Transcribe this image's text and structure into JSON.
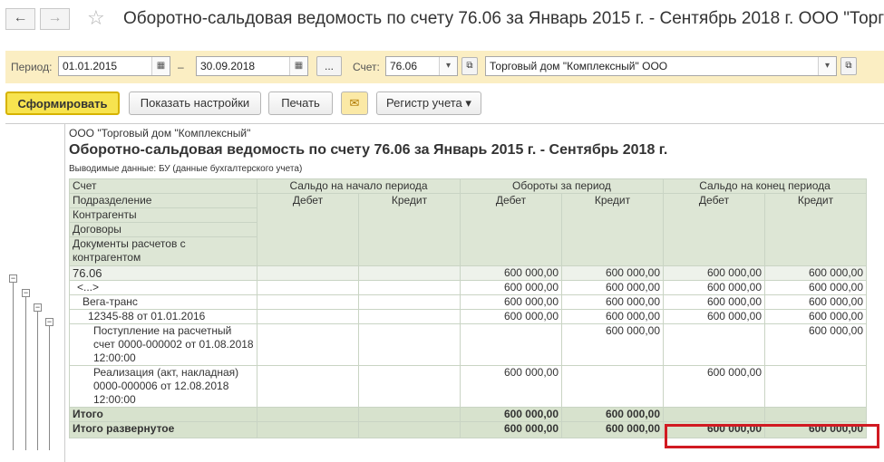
{
  "window": {
    "back_glyph": "←",
    "forward_glyph": "→",
    "star_glyph": "☆",
    "title": "Оборотно-сальдовая ведомость по счету 76.06 за Январь 2015 г. - Сентябрь 2018 г. ООО \"Торг"
  },
  "params": {
    "period_label": "Период:",
    "date_from": "01.01.2015",
    "dash": "–",
    "date_to": "30.09.2018",
    "more_label": "...",
    "account_label": "Счет:",
    "account_value": "76.06",
    "org_value": "Торговый дом \"Комплексный\" ООО"
  },
  "toolbar": {
    "generate": "Сформировать",
    "settings": "Показать настройки",
    "print": "Печать",
    "email_glyph": "✉",
    "register": "Регистр учета",
    "register_arrow": "▾"
  },
  "report": {
    "org": "ООО \"Торговый дом \"Комплексный\"",
    "title": "Оборотно-сальдовая ведомость по счету 76.06 за Январь 2015 г. - Сентябрь 2018 г.",
    "output_data": "Выводимые данные:  БУ (данные бухгалтерского учета)",
    "header": {
      "col_account": [
        "Счет",
        "Подразделение",
        "Контрагенты",
        "Договоры",
        "Документы расчетов с контрагентом"
      ],
      "opening": "Сальдо на начало периода",
      "turnover": "Обороты за период",
      "closing": "Сальдо на конец периода",
      "debit": "Дебет",
      "credit": "Кредит"
    },
    "rows": [
      {
        "name": "76.06",
        "od": "",
        "oc": "",
        "td": "600 000,00",
        "tc": "600 000,00",
        "cd": "600 000,00",
        "cc": "600 000,00"
      },
      {
        "name": "<...>",
        "od": "",
        "oc": "",
        "td": "600 000,00",
        "tc": "600 000,00",
        "cd": "600 000,00",
        "cc": "600 000,00"
      },
      {
        "name": "Вега-транс",
        "od": "",
        "oc": "",
        "td": "600 000,00",
        "tc": "600 000,00",
        "cd": "600 000,00",
        "cc": "600 000,00"
      },
      {
        "name": "12345-88 от 01.01.2016",
        "od": "",
        "oc": "",
        "td": "600 000,00",
        "tc": "600 000,00",
        "cd": "600 000,00",
        "cc": "600 000,00"
      },
      {
        "name": "Поступление на расчетный счет 0000-000002 от 01.08.2018 12:00:00",
        "od": "",
        "oc": "",
        "td": "",
        "tc": "600 000,00",
        "cd": "",
        "cc": "600 000,00"
      },
      {
        "name": "Реализация (акт, накладная) 0000-000006 от 12.08.2018 12:00:00",
        "od": "",
        "oc": "",
        "td": "600 000,00",
        "tc": "",
        "cd": "600 000,00",
        "cc": ""
      }
    ],
    "totals": [
      {
        "name": "Итого",
        "td": "600 000,00",
        "tc": "600 000,00",
        "cd": "",
        "cc": ""
      },
      {
        "name": "Итого развернутое",
        "td": "600 000,00",
        "tc": "600 000,00",
        "cd": "600 000,00",
        "cc": "600 000,00"
      }
    ],
    "tree_glyph": "−"
  },
  "colors": {
    "params_bg": "#fbeec3",
    "primary_button": "#f7e34f",
    "header_bg": "#dde6d5",
    "highlight": "#d11a22"
  }
}
